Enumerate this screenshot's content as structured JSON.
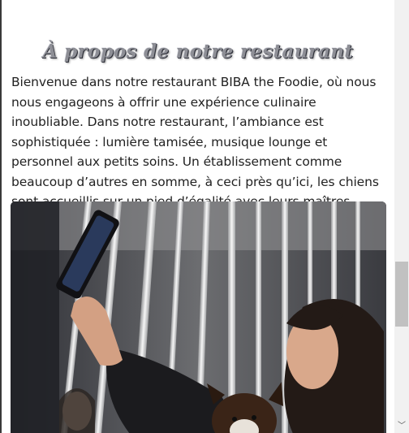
{
  "about": {
    "heading": "À propos de notre restaurant",
    "intro": "Bienvenue dans notre restaurant BIBA the Foodie, où nous nous engageons à offrir une expérience culinaire inoubliable. Dans notre restaurant, l’ambiance est sophistiquée : lumière tamisée, musique lounge et personnel aux petits soins. Un établissement comme beaucoup d’autres en somme, à ceci près qu’ici, les chiens sont accueillis sur un pied d’égalité avec leurs maîtres."
  },
  "photo": {
    "subject": "woman-taking-selfie-with-dog"
  },
  "scrollbar": {
    "down_arrow": "﹀"
  },
  "colors": {
    "text": "#222222",
    "heading_fill": "#8e8f96",
    "heading_shadow": "#2d2f38",
    "scrollbar_track": "#f1f1f1",
    "scrollbar_thumb": "#c1c1c1"
  }
}
